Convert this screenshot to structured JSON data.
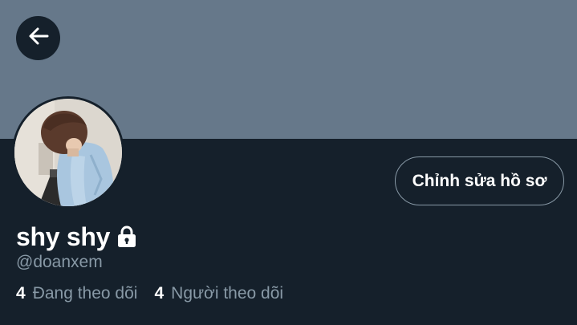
{
  "profile": {
    "display_name": "shy shy",
    "handle": "@doanxem",
    "edit_button_label": "Chỉnh sửa hồ sơ",
    "following_count": "4",
    "following_label": "Đang theo dõi",
    "followers_count": "4",
    "followers_label": "Người theo dõi",
    "protected": true
  },
  "icons": {
    "back": "arrow-left-icon",
    "lock": "lock-icon"
  },
  "colors": {
    "background": "#15202b",
    "banner": "#66788a",
    "primary_text": "#ffffff",
    "secondary_text": "#8899a6",
    "button_border": "#8899a6"
  }
}
